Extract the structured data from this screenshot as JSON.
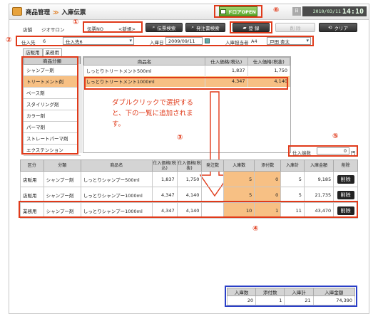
{
  "header": {
    "app_title": "商品管理",
    "separator": "≫",
    "screen_title": "入庫伝票",
    "drawer_open": "ドロアOPEN",
    "clock_label": "日",
    "clock_date": "2010/03/11",
    "clock_time": "14:10"
  },
  "toolbar": {
    "store_label": "店舗",
    "store_value": "ジオサロン",
    "slip_no_label": "伝票NO",
    "slip_no_value": "<新規>",
    "slip_search": "伝票検索",
    "order_search": "発注書検索",
    "register": "登 録",
    "delete": "削 除",
    "clear": "クリア"
  },
  "form": {
    "supplier_label": "仕入先",
    "supplier_code": "6",
    "supplier_name": "仕入先6",
    "date_label": "入庫日",
    "date_value": "2009/09/11",
    "staff_label": "入庫担当者",
    "staff_code": "A4",
    "staff_name": "戸田 杏太"
  },
  "category_panel": {
    "tabs": [
      "店販用",
      "業務用"
    ],
    "header": "商品分類",
    "items": [
      "シャンプー剤",
      "トリートメント剤",
      "ベース剤",
      "スタイリング剤",
      "カラー剤",
      "パーマ剤",
      "ストレートパーマ剤",
      "エクステンション"
    ],
    "selected_index": 1
  },
  "product_table": {
    "headers": [
      "商品名",
      "仕入価格(税込)",
      "仕入価格(税抜)"
    ],
    "rows": [
      {
        "name": "しっとりトリートメント500ml",
        "price_incl": "1,837",
        "price_excl": "1,750"
      },
      {
        "name": "しっとりトリートメント1000ml",
        "price_incl": "4,347",
        "price_excl": "4,140"
      }
    ]
  },
  "instruction": "ダブルクリックで選択すると、下の一覧に追加されます。",
  "tax_rate": {
    "label": "仕入端数",
    "value": "0",
    "unit": "円"
  },
  "detail_table": {
    "headers": [
      "区分",
      "分類",
      "商品名",
      "仕入価格(税込)",
      "仕入価格(税抜)",
      "発注数",
      "入庫数",
      "添付数",
      "入庫計",
      "入庫金額",
      "削除"
    ],
    "delete_label": "削除",
    "rows": [
      {
        "kubun": "店販用",
        "bunrui": "シャンプー剤",
        "name": "しっとりシャンプー500ml",
        "p_incl": "1,837",
        "p_excl": "1,750",
        "order": "",
        "qty": "5",
        "extra": "0",
        "total": "5",
        "amount": "9,185"
      },
      {
        "kubun": "店販用",
        "bunrui": "シャンプー剤",
        "name": "しっとりシャンプー1000ml",
        "p_incl": "4,347",
        "p_excl": "4,140",
        "order": "",
        "qty": "5",
        "extra": "0",
        "total": "5",
        "amount": "21,735"
      },
      {
        "kubun": "業務用",
        "bunrui": "シャンプー剤",
        "name": "しっとりシャンプー1000ml",
        "p_incl": "4,347",
        "p_excl": "4,140",
        "order": "",
        "qty": "10",
        "extra": "1",
        "total": "11",
        "amount": "43,470"
      }
    ]
  },
  "summary": {
    "headers": [
      "入庫数",
      "添付数",
      "入庫計",
      "入庫金額"
    ],
    "values": [
      "20",
      "1",
      "21",
      "74,390"
    ]
  },
  "markers": [
    "①",
    "②",
    "③",
    "④",
    "⑤",
    "⑥"
  ],
  "colors": {
    "accent_red": "#e03a1a",
    "highlight_orange": "#f7c084",
    "drawer_green": "#5aa62c"
  }
}
